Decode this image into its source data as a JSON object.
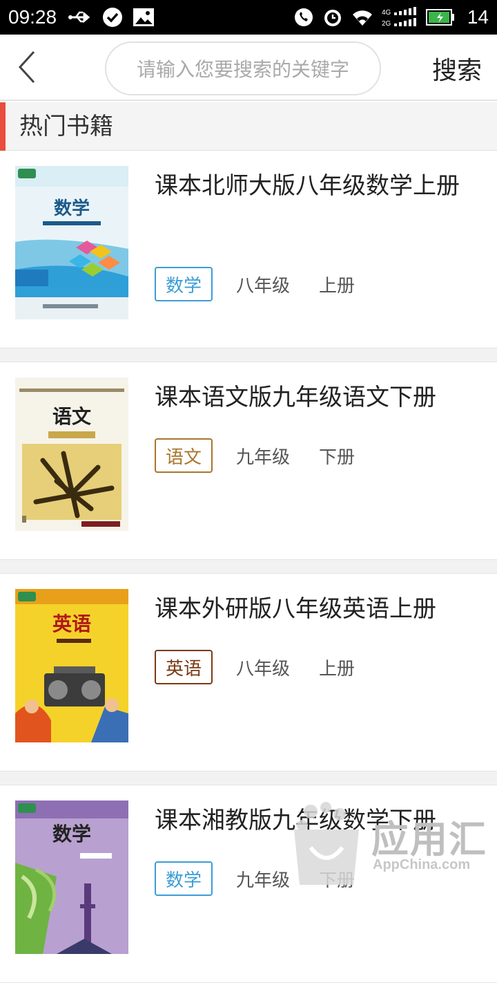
{
  "status_bar": {
    "time": "09:28",
    "battery_pct": "14",
    "signal_labels": [
      "4G",
      "2G"
    ],
    "icons": [
      "usb-icon",
      "check-circle-icon",
      "image-icon",
      "call-icon",
      "alarm-icon",
      "wifi-icon",
      "signal-icon",
      "battery-icon"
    ]
  },
  "header": {
    "back_icon": "chevron-left-icon",
    "search_placeholder": "请输入您要搜索的关键字",
    "search_label": "搜索"
  },
  "section": {
    "title": "热门书籍",
    "accent_color": "#e84d3d"
  },
  "books": [
    {
      "title": "课本北师大版八年级数学上册",
      "subject": "数学",
      "grade": "八年级",
      "volume": "上册",
      "tag_color": "#3b9dd6",
      "cover_title": "数学"
    },
    {
      "title": "课本语文版九年级语文下册",
      "subject": "语文",
      "grade": "九年级",
      "volume": "下册",
      "tag_color": "#a8762b",
      "cover_title": "语文"
    },
    {
      "title": "课本外研版八年级英语上册",
      "subject": "英语",
      "grade": "八年级",
      "volume": "上册",
      "tag_color": "#7a3a13",
      "cover_title": "英语"
    },
    {
      "title": "课本湘教版九年级数学下册",
      "subject": "数学",
      "grade": "九年级",
      "volume": "下册",
      "tag_color": "#3b9dd6",
      "cover_title": "数学"
    }
  ],
  "watermark": {
    "text": "应用汇",
    "url": "AppChina.com"
  }
}
